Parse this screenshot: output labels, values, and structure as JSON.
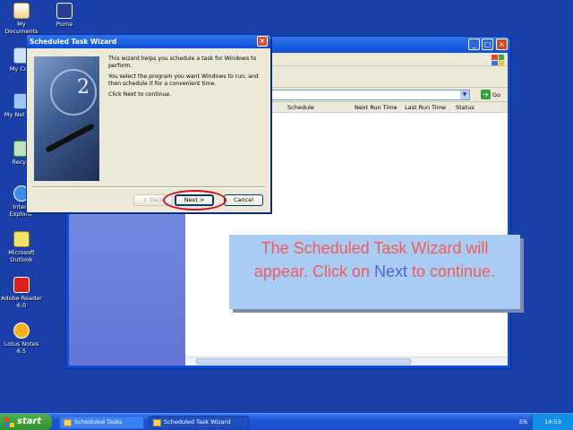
{
  "desktop": {
    "icons": [
      {
        "label": "My Documents",
        "icon": "folder-documents-icon"
      },
      {
        "label": "Puma",
        "icon": "puma-app-icon"
      },
      {
        "label": "My Com",
        "icon": "computer-icon"
      },
      {
        "label": "My Net Plac",
        "icon": "network-places-icon"
      },
      {
        "label": "Recycl",
        "icon": "recycle-bin-icon"
      },
      {
        "label": "Intern Explorer",
        "icon": "internet-explorer-icon"
      },
      {
        "label": "Microsoft Outlook",
        "icon": "outlook-icon"
      },
      {
        "label": "Adobe Reader 6.0",
        "icon": "adobe-reader-icon"
      },
      {
        "label": "Lotus Notes 6.5",
        "icon": "lotus-notes-icon"
      }
    ]
  },
  "explorer": {
    "address_go_label": "Go",
    "columns": [
      "Schedule",
      "Next Run Time",
      "Last Run Time",
      "Status"
    ]
  },
  "wizard": {
    "title": "Scheduled Task Wizard",
    "para1": "This wizard helps you schedule a task for Windows to perform.",
    "para2": "You select the program you want Windows to run, and then schedule it for a convenient time.",
    "para3": "Click Next to continue.",
    "back_label": "< Back",
    "next_label": "Next >",
    "cancel_label": "Cancel"
  },
  "callout": {
    "text_before": "The Scheduled Task Wizard will appear. Click on ",
    "highlight": "Next",
    "text_after": " to continue."
  },
  "taskbar": {
    "start_label": "start",
    "tasks": [
      {
        "label": "Scheduled Tasks",
        "active": false
      },
      {
        "label": "Scheduled Task Wizard",
        "active": true
      }
    ],
    "language": "EN",
    "clock": "14:53"
  },
  "colors": {
    "desktop": "#1a3fa8",
    "title_bar": "#0a4fd6",
    "callout_bg": "#a9ccf5",
    "callout_text": "#f25a5a",
    "callout_highlight": "#5263d8",
    "highlight_ring": "#d0101a"
  }
}
